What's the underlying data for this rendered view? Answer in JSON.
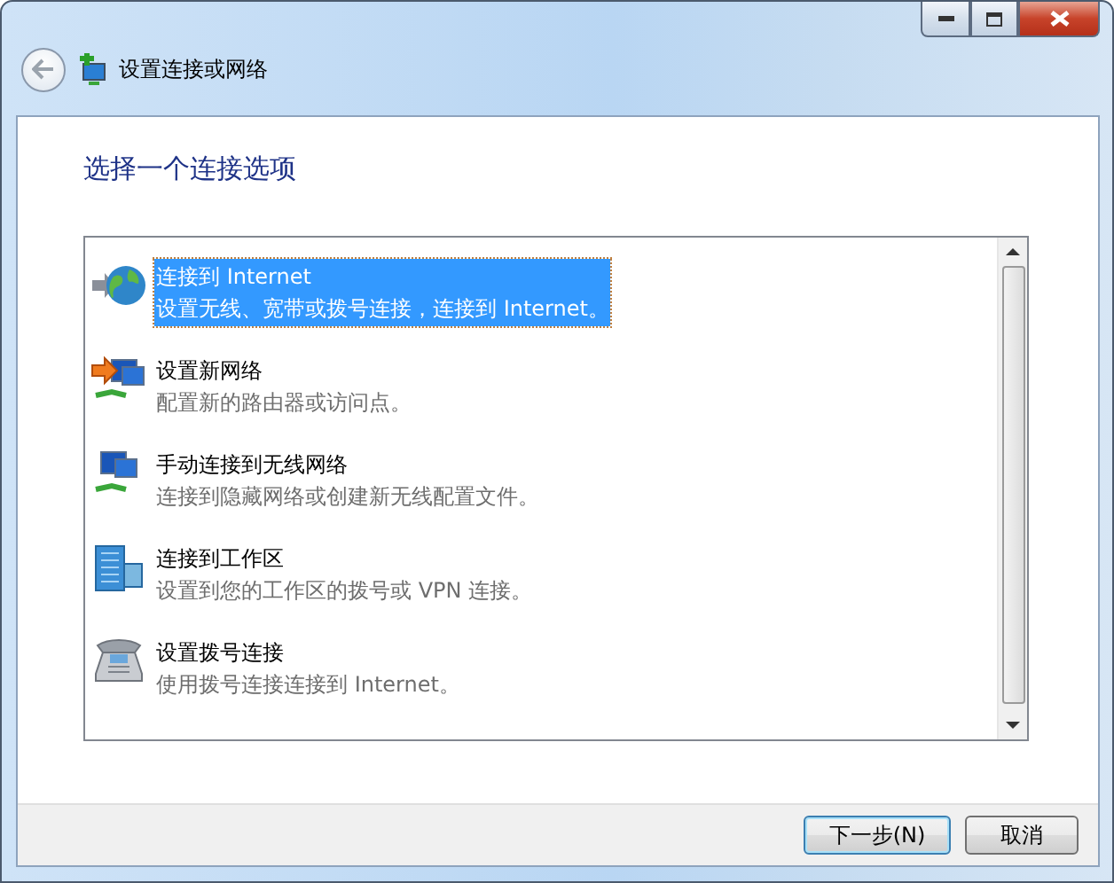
{
  "window": {
    "title": "设置连接或网络"
  },
  "heading": "选择一个连接选项",
  "options": [
    {
      "kind": "globe",
      "title": "连接到 Internet",
      "description": "设置无线、宽带或拨号连接，连接到 Internet。",
      "selected": true
    },
    {
      "kind": "new-network",
      "title": "设置新网络",
      "description": "配置新的路由器或访问点。",
      "selected": false
    },
    {
      "kind": "wireless",
      "title": "手动连接到无线网络",
      "description": "连接到隐藏网络或创建新无线配置文件。",
      "selected": false
    },
    {
      "kind": "workplace",
      "title": "连接到工作区",
      "description": "设置到您的工作区的拨号或 VPN 连接。",
      "selected": false
    },
    {
      "kind": "phone",
      "title": "设置拨号连接",
      "description": "使用拨号连接连接到 Internet。",
      "selected": false
    }
  ],
  "buttons": [
    {
      "label": "下一步(N)",
      "default": true
    },
    {
      "label": "取消",
      "default": false
    }
  ]
}
